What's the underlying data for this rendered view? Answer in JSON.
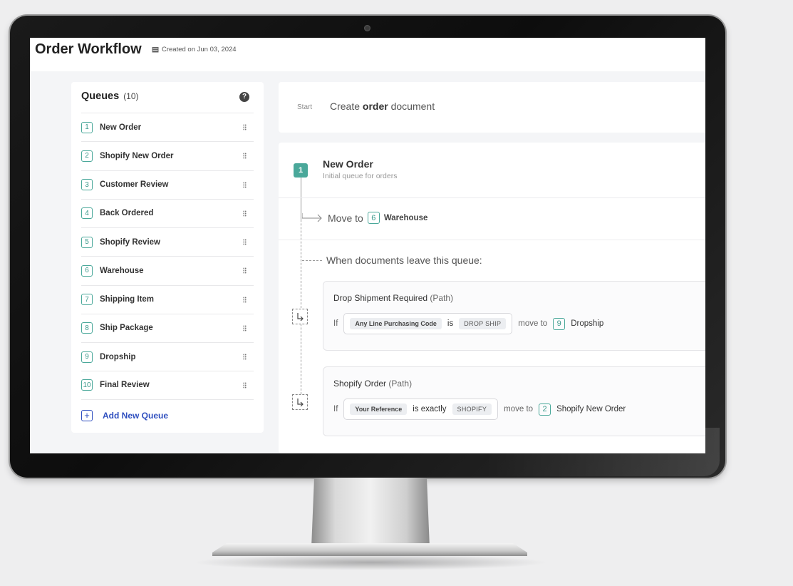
{
  "app": {
    "title": "Order Workflow",
    "created": "Created on Jun 03, 2024"
  },
  "queues": {
    "title": "Queues",
    "count": "(10)",
    "items": [
      {
        "num": "1",
        "label": "New Order"
      },
      {
        "num": "2",
        "label": "Shopify New Order"
      },
      {
        "num": "3",
        "label": "Customer Review"
      },
      {
        "num": "4",
        "label": "Back Ordered"
      },
      {
        "num": "5",
        "label": "Shopify Review"
      },
      {
        "num": "6",
        "label": "Warehouse"
      },
      {
        "num": "7",
        "label": "Shipping Item"
      },
      {
        "num": "8",
        "label": "Ship Package"
      },
      {
        "num": "9",
        "label": "Dropship"
      },
      {
        "num": "10",
        "label": "Final Review"
      }
    ],
    "add_label": "Add New Queue"
  },
  "start": {
    "tag": "Start",
    "text_a": "Create ",
    "text_b": "order",
    "text_c": " document"
  },
  "step": {
    "num": "1",
    "title": "New Order",
    "subtitle": "Initial queue for orders",
    "move_label": "Move to",
    "move_num": "6",
    "move_target": "Warehouse",
    "when_label": "When documents leave this queue:"
  },
  "paths": [
    {
      "title": "Drop Shipment Required",
      "suffix": "(Path)",
      "if": "If",
      "field": "Any Line Purchasing Code",
      "op": "is",
      "value": "DROP SHIP",
      "move_to": "move to",
      "target_num": "9",
      "target": "Dropship"
    },
    {
      "title": "Shopify Order",
      "suffix": "(Path)",
      "if": "If",
      "field": "Your Reference",
      "op": "is exactly",
      "value": "SHOPIFY",
      "move_to": "move to",
      "target_num": "2",
      "target": "Shopify New Order"
    }
  ],
  "colors": {
    "accent": "#4aa89a",
    "link": "#2f4fbf",
    "bezel": "#111111"
  }
}
